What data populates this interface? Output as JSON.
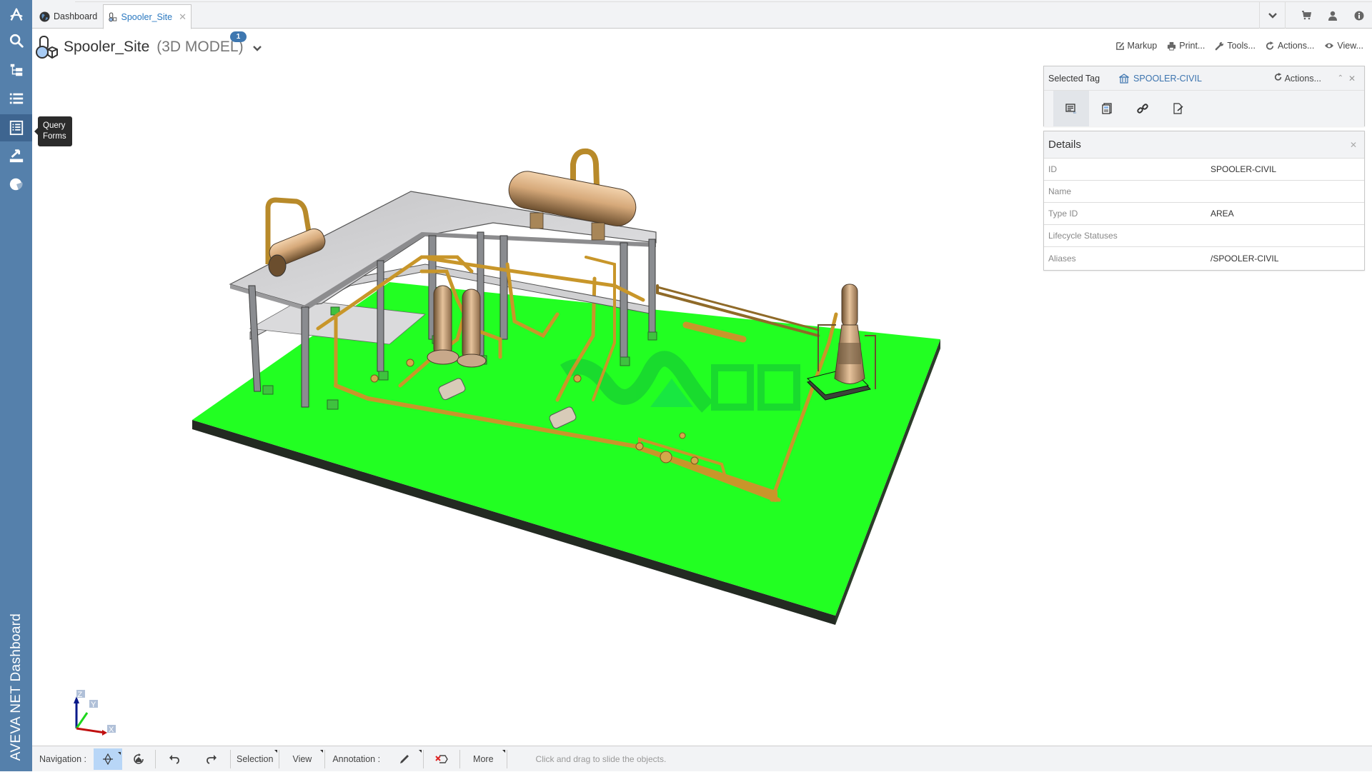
{
  "app": {
    "brand_vertical": "AVEVA NET Dashboard",
    "accent_color": "#5580ab",
    "link_color": "#3b73ae"
  },
  "sidebar": {
    "items": [
      {
        "icon": "aveva-logo-icon",
        "label": "Home"
      },
      {
        "icon": "search-icon",
        "label": "Search"
      },
      {
        "icon": "hierarchy-icon",
        "label": "Hierarchy"
      },
      {
        "icon": "list-icon",
        "label": "Lists"
      },
      {
        "icon": "query-forms-icon",
        "label": "Query Forms",
        "active": true
      },
      {
        "icon": "export-icon",
        "label": "Export"
      },
      {
        "icon": "pie-chart-icon",
        "label": "Reports"
      }
    ],
    "tooltip_line1": "Query",
    "tooltip_line2": "Forms"
  },
  "tabs": [
    {
      "label": "Dashboard",
      "icon": "globe-icon",
      "active": false
    },
    {
      "label": "Spooler_Site",
      "icon": "3d-model-icon",
      "active": true,
      "close": "✕"
    }
  ],
  "tab_icons": {
    "dropdown": "chevron-down-icon",
    "cart": "cart-icon",
    "user": "user-icon",
    "info": "info-icon"
  },
  "header": {
    "title": "Spooler_Site",
    "subtitle": "(3D MODEL)",
    "badge_count": "1"
  },
  "toolbar_actions": [
    {
      "label": "Markup",
      "icon": "markup-icon"
    },
    {
      "label": "Print...",
      "icon": "print-icon"
    },
    {
      "label": "Tools...",
      "icon": "wrench-icon"
    },
    {
      "label": "Actions...",
      "icon": "actions-icon"
    },
    {
      "label": "View...",
      "icon": "eye-icon"
    }
  ],
  "selected_tag_panel": {
    "label": "Selected Tag",
    "tag": "SPOOLER-CIVIL",
    "actions_label": "Actions...",
    "tools": [
      "details-icon",
      "documents-icon",
      "link-icon",
      "edit-document-icon"
    ]
  },
  "details_panel": {
    "title": "Details",
    "rows": [
      {
        "key": "ID",
        "value": "SPOOLER-CIVIL"
      },
      {
        "key": "Name",
        "value": ""
      },
      {
        "key": "Type ID",
        "value": "AREA"
      },
      {
        "key": "Lifecycle Statuses",
        "value": ""
      },
      {
        "key": "Aliases",
        "value": "/SPOOLER-CIVIL"
      }
    ]
  },
  "viewport": {
    "axes": {
      "x": "X",
      "y": "Y",
      "z": "Z"
    },
    "slab_color": "#22ff22",
    "steel_color": "#c8c8c8",
    "pipe_color": "#c8962a",
    "vessel_color": "#dbb088"
  },
  "bottom_toolbar": {
    "navigation_label": "Navigation :",
    "selection_label": "Selection",
    "view_label": "View",
    "annotation_label": "Annotation :",
    "more_label": "More",
    "status_text": "Click and drag to slide the objects."
  }
}
